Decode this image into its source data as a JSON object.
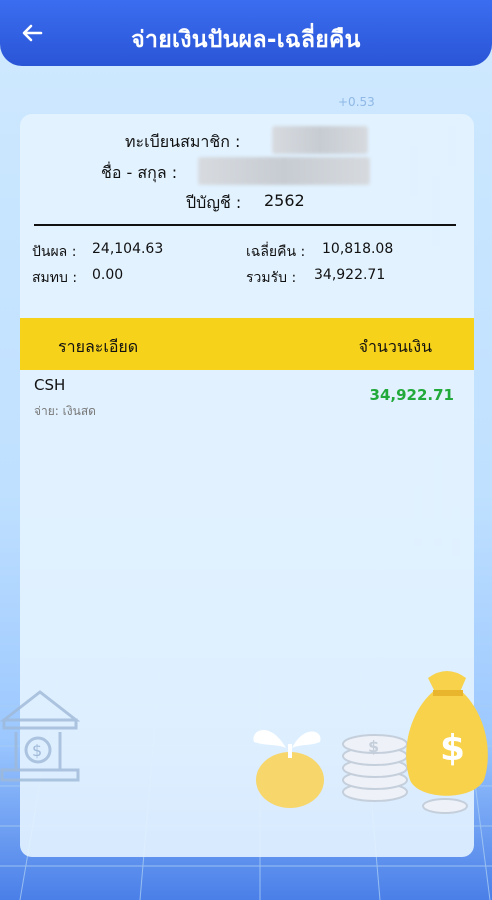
{
  "header": {
    "title": "จ่ายเงินปันผล-เฉลี่ยคืน",
    "back_icon": "arrow-left-icon"
  },
  "member": {
    "member_no_label": "ทะเบียนสมาชิก :",
    "name_label": "ชื่อ - สกุล :",
    "year_label": "ปีบัญชี :",
    "year_value": "2562"
  },
  "summary": {
    "dividend_label": "ปันผล :",
    "dividend_value": "24,104.63",
    "refund_label": "เฉลี่ยคืน :",
    "refund_value": "10,818.08",
    "deduct_label": "สมทบ :",
    "deduct_value": "0.00",
    "total_label": "รวมรับ :",
    "total_value": "34,922.71"
  },
  "table": {
    "col_detail": "รายละเอียด",
    "col_amount": "จำนวนเงิน",
    "rows": [
      {
        "code": "CSH",
        "desc": "จ่าย: เงินสด",
        "amount": "34,922.71"
      }
    ]
  },
  "background": {
    "ticker_text": "+0.53"
  },
  "colors": {
    "header_blue": "#2f5fe3",
    "table_head_yellow": "#f6d21a",
    "amount_green": "#21a93a"
  }
}
